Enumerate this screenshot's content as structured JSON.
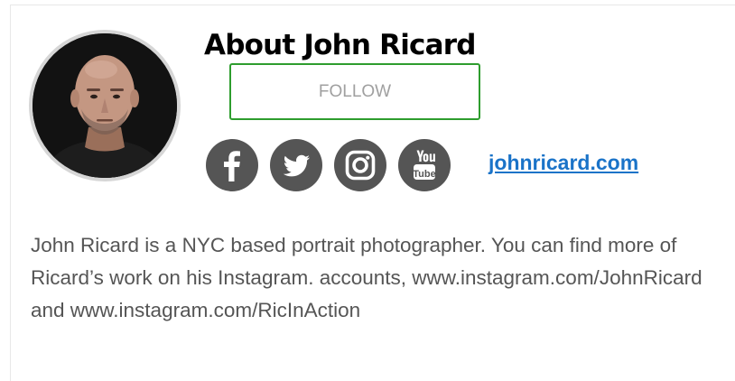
{
  "profile": {
    "title": "About John Ricard",
    "follow_label": "FOLLOW",
    "website_label": "johnricard.com",
    "bio": "John Ricard is a NYC based portrait photographer. You can find more of Ricard’s work on his Instagram. accounts, www.instagram.com/JohnRicard and www.instagram.com/RicInAction"
  },
  "social_icons": [
    "facebook-icon",
    "twitter-icon",
    "instagram-icon",
    "youtube-icon"
  ],
  "colors": {
    "follow_border": "#2e9d2e",
    "follow_text": "#a0a0a0",
    "social_bg": "#555555",
    "link": "#1a73c8",
    "bio_text": "#555555",
    "avatar_ring": "#d6d6d6"
  }
}
